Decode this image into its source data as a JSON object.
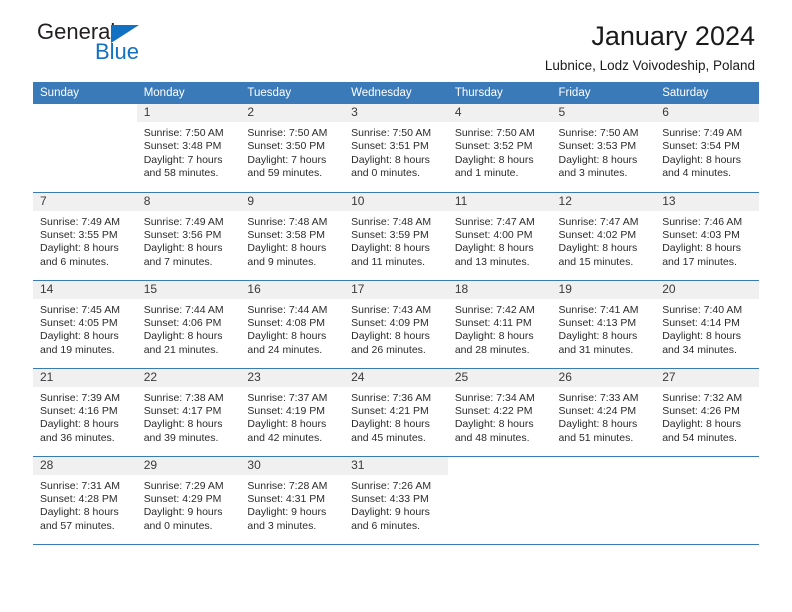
{
  "brand": {
    "line1": "General",
    "line2": "Blue",
    "triangle_color": "#1371c3",
    "text_color": "#231f20"
  },
  "header": {
    "title": "January 2024",
    "subtitle": "Lubnice, Lodz Voivodeship, Poland"
  },
  "colors": {
    "header_blue": "#3b7ab8",
    "daynum_bg": "#f0f0f0",
    "text": "#2b2b2b"
  },
  "weekday_headers": [
    "Sunday",
    "Monday",
    "Tuesday",
    "Wednesday",
    "Thursday",
    "Friday",
    "Saturday"
  ],
  "weeks": [
    [
      {
        "day": "",
        "blank": true,
        "sunrise": "",
        "sunset": "",
        "daylight1": "",
        "daylight2": ""
      },
      {
        "day": "1",
        "sunrise": "Sunrise: 7:50 AM",
        "sunset": "Sunset: 3:48 PM",
        "daylight1": "Daylight: 7 hours",
        "daylight2": "and 58 minutes."
      },
      {
        "day": "2",
        "sunrise": "Sunrise: 7:50 AM",
        "sunset": "Sunset: 3:50 PM",
        "daylight1": "Daylight: 7 hours",
        "daylight2": "and 59 minutes."
      },
      {
        "day": "3",
        "sunrise": "Sunrise: 7:50 AM",
        "sunset": "Sunset: 3:51 PM",
        "daylight1": "Daylight: 8 hours",
        "daylight2": "and 0 minutes."
      },
      {
        "day": "4",
        "sunrise": "Sunrise: 7:50 AM",
        "sunset": "Sunset: 3:52 PM",
        "daylight1": "Daylight: 8 hours",
        "daylight2": "and 1 minute."
      },
      {
        "day": "5",
        "sunrise": "Sunrise: 7:50 AM",
        "sunset": "Sunset: 3:53 PM",
        "daylight1": "Daylight: 8 hours",
        "daylight2": "and 3 minutes."
      },
      {
        "day": "6",
        "sunrise": "Sunrise: 7:49 AM",
        "sunset": "Sunset: 3:54 PM",
        "daylight1": "Daylight: 8 hours",
        "daylight2": "and 4 minutes."
      }
    ],
    [
      {
        "day": "7",
        "sunrise": "Sunrise: 7:49 AM",
        "sunset": "Sunset: 3:55 PM",
        "daylight1": "Daylight: 8 hours",
        "daylight2": "and 6 minutes."
      },
      {
        "day": "8",
        "sunrise": "Sunrise: 7:49 AM",
        "sunset": "Sunset: 3:56 PM",
        "daylight1": "Daylight: 8 hours",
        "daylight2": "and 7 minutes."
      },
      {
        "day": "9",
        "sunrise": "Sunrise: 7:48 AM",
        "sunset": "Sunset: 3:58 PM",
        "daylight1": "Daylight: 8 hours",
        "daylight2": "and 9 minutes."
      },
      {
        "day": "10",
        "sunrise": "Sunrise: 7:48 AM",
        "sunset": "Sunset: 3:59 PM",
        "daylight1": "Daylight: 8 hours",
        "daylight2": "and 11 minutes."
      },
      {
        "day": "11",
        "sunrise": "Sunrise: 7:47 AM",
        "sunset": "Sunset: 4:00 PM",
        "daylight1": "Daylight: 8 hours",
        "daylight2": "and 13 minutes."
      },
      {
        "day": "12",
        "sunrise": "Sunrise: 7:47 AM",
        "sunset": "Sunset: 4:02 PM",
        "daylight1": "Daylight: 8 hours",
        "daylight2": "and 15 minutes."
      },
      {
        "day": "13",
        "sunrise": "Sunrise: 7:46 AM",
        "sunset": "Sunset: 4:03 PM",
        "daylight1": "Daylight: 8 hours",
        "daylight2": "and 17 minutes."
      }
    ],
    [
      {
        "day": "14",
        "sunrise": "Sunrise: 7:45 AM",
        "sunset": "Sunset: 4:05 PM",
        "daylight1": "Daylight: 8 hours",
        "daylight2": "and 19 minutes."
      },
      {
        "day": "15",
        "sunrise": "Sunrise: 7:44 AM",
        "sunset": "Sunset: 4:06 PM",
        "daylight1": "Daylight: 8 hours",
        "daylight2": "and 21 minutes."
      },
      {
        "day": "16",
        "sunrise": "Sunrise: 7:44 AM",
        "sunset": "Sunset: 4:08 PM",
        "daylight1": "Daylight: 8 hours",
        "daylight2": "and 24 minutes."
      },
      {
        "day": "17",
        "sunrise": "Sunrise: 7:43 AM",
        "sunset": "Sunset: 4:09 PM",
        "daylight1": "Daylight: 8 hours",
        "daylight2": "and 26 minutes."
      },
      {
        "day": "18",
        "sunrise": "Sunrise: 7:42 AM",
        "sunset": "Sunset: 4:11 PM",
        "daylight1": "Daylight: 8 hours",
        "daylight2": "and 28 minutes."
      },
      {
        "day": "19",
        "sunrise": "Sunrise: 7:41 AM",
        "sunset": "Sunset: 4:13 PM",
        "daylight1": "Daylight: 8 hours",
        "daylight2": "and 31 minutes."
      },
      {
        "day": "20",
        "sunrise": "Sunrise: 7:40 AM",
        "sunset": "Sunset: 4:14 PM",
        "daylight1": "Daylight: 8 hours",
        "daylight2": "and 34 minutes."
      }
    ],
    [
      {
        "day": "21",
        "sunrise": "Sunrise: 7:39 AM",
        "sunset": "Sunset: 4:16 PM",
        "daylight1": "Daylight: 8 hours",
        "daylight2": "and 36 minutes."
      },
      {
        "day": "22",
        "sunrise": "Sunrise: 7:38 AM",
        "sunset": "Sunset: 4:17 PM",
        "daylight1": "Daylight: 8 hours",
        "daylight2": "and 39 minutes."
      },
      {
        "day": "23",
        "sunrise": "Sunrise: 7:37 AM",
        "sunset": "Sunset: 4:19 PM",
        "daylight1": "Daylight: 8 hours",
        "daylight2": "and 42 minutes."
      },
      {
        "day": "24",
        "sunrise": "Sunrise: 7:36 AM",
        "sunset": "Sunset: 4:21 PM",
        "daylight1": "Daylight: 8 hours",
        "daylight2": "and 45 minutes."
      },
      {
        "day": "25",
        "sunrise": "Sunrise: 7:34 AM",
        "sunset": "Sunset: 4:22 PM",
        "daylight1": "Daylight: 8 hours",
        "daylight2": "and 48 minutes."
      },
      {
        "day": "26",
        "sunrise": "Sunrise: 7:33 AM",
        "sunset": "Sunset: 4:24 PM",
        "daylight1": "Daylight: 8 hours",
        "daylight2": "and 51 minutes."
      },
      {
        "day": "27",
        "sunrise": "Sunrise: 7:32 AM",
        "sunset": "Sunset: 4:26 PM",
        "daylight1": "Daylight: 8 hours",
        "daylight2": "and 54 minutes."
      }
    ],
    [
      {
        "day": "28",
        "sunrise": "Sunrise: 7:31 AM",
        "sunset": "Sunset: 4:28 PM",
        "daylight1": "Daylight: 8 hours",
        "daylight2": "and 57 minutes."
      },
      {
        "day": "29",
        "sunrise": "Sunrise: 7:29 AM",
        "sunset": "Sunset: 4:29 PM",
        "daylight1": "Daylight: 9 hours",
        "daylight2": "and 0 minutes."
      },
      {
        "day": "30",
        "sunrise": "Sunrise: 7:28 AM",
        "sunset": "Sunset: 4:31 PM",
        "daylight1": "Daylight: 9 hours",
        "daylight2": "and 3 minutes."
      },
      {
        "day": "31",
        "sunrise": "Sunrise: 7:26 AM",
        "sunset": "Sunset: 4:33 PM",
        "daylight1": "Daylight: 9 hours",
        "daylight2": "and 6 minutes."
      },
      {
        "day": "",
        "blank": true,
        "sunrise": "",
        "sunset": "",
        "daylight1": "",
        "daylight2": ""
      },
      {
        "day": "",
        "blank": true,
        "sunrise": "",
        "sunset": "",
        "daylight1": "",
        "daylight2": ""
      },
      {
        "day": "",
        "blank": true,
        "sunrise": "",
        "sunset": "",
        "daylight1": "",
        "daylight2": ""
      }
    ]
  ]
}
